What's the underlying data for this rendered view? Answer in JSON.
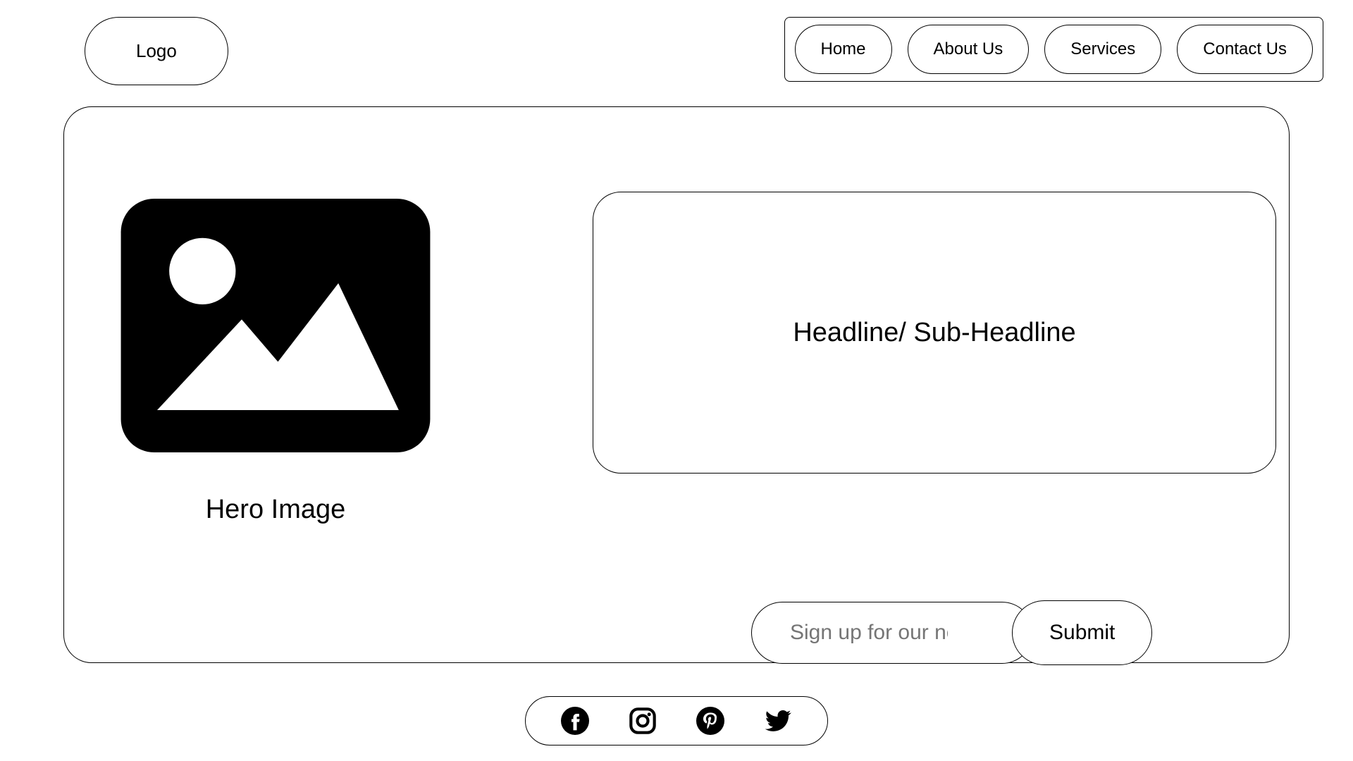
{
  "header": {
    "logo": "Logo",
    "nav": [
      "Home",
      "About Us",
      "Services",
      "Contact Us"
    ]
  },
  "hero": {
    "image_label": "Hero Image",
    "headline": "Headline/ Sub-Headline",
    "newsletter_placeholder": "Sign up for our newsletter",
    "submit_label": "Submit"
  },
  "social": {
    "icons": [
      "facebook",
      "instagram",
      "pinterest",
      "twitter"
    ]
  }
}
